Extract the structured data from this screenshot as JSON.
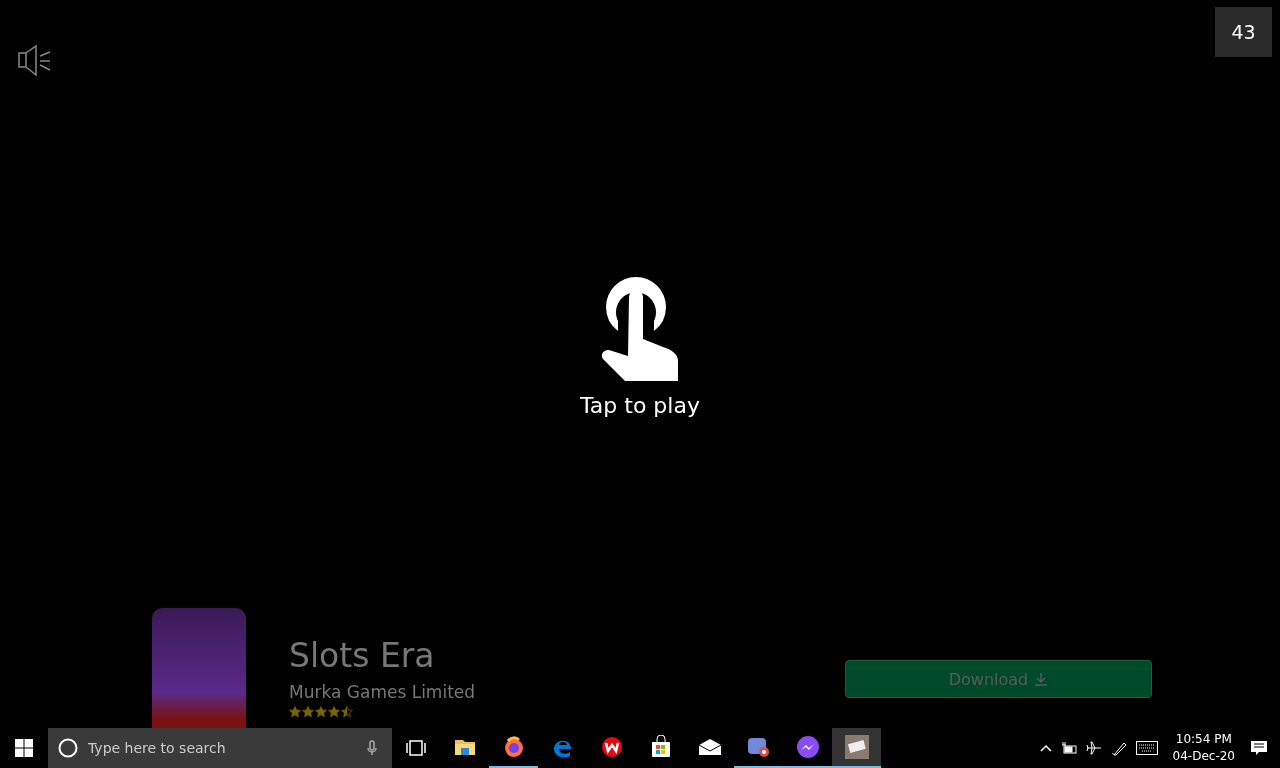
{
  "game": {
    "countdown": "43",
    "prompt": "Tap to play"
  },
  "ad": {
    "title": "Slots Era",
    "publisher": "Murka Games Limited",
    "stars": 4.5,
    "button": "Download"
  },
  "taskbar": {
    "search": {
      "placeholder": "Type here to search"
    },
    "apps": [
      {
        "kind": "folder",
        "running": false,
        "selected": false
      },
      {
        "kind": "firefox",
        "running": true,
        "selected": false
      },
      {
        "kind": "edge",
        "running": false,
        "selected": false
      },
      {
        "kind": "wish",
        "running": false,
        "selected": false
      },
      {
        "kind": "store",
        "running": false,
        "selected": false
      },
      {
        "kind": "mail",
        "running": false,
        "selected": false
      },
      {
        "kind": "discord",
        "running": true,
        "selected": false
      },
      {
        "kind": "messenger",
        "running": true,
        "selected": false
      },
      {
        "kind": "game",
        "running": true,
        "selected": true
      }
    ],
    "time": "10:54 PM",
    "date": "04-Dec-20"
  }
}
